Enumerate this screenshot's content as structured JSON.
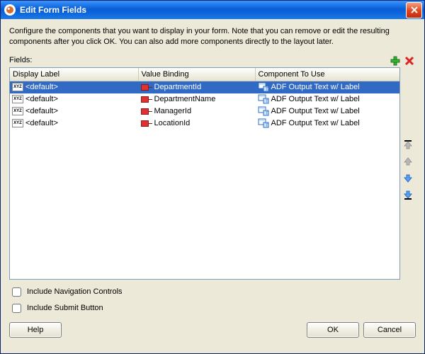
{
  "window": {
    "title": "Edit Form Fields"
  },
  "description": "Configure the components that you want to display in your form.  Note that you can remove or edit the resulting components after you click OK.  You can also add more components directly to the layout later.",
  "fieldsLabel": "Fields:",
  "columns": {
    "displayLabel": "Display Label",
    "valueBinding": "Value Binding",
    "componentToUse": "Component To Use"
  },
  "rows": [
    {
      "label": "<default>",
      "binding": "DepartmentId",
      "component": "ADF Output Text w/ Label",
      "selected": true
    },
    {
      "label": "<default>",
      "binding": "DepartmentName",
      "component": "ADF Output Text w/ Label",
      "selected": false
    },
    {
      "label": "<default>",
      "binding": "ManagerId",
      "component": "ADF Output Text w/ Label",
      "selected": false
    },
    {
      "label": "<default>",
      "binding": "LocationId",
      "component": "ADF Output Text w/ Label",
      "selected": false
    }
  ],
  "options": {
    "includeNavigationControls": {
      "label": "Include Navigation Controls",
      "checked": false
    },
    "includeSubmitButton": {
      "label": "Include Submit Button",
      "checked": false
    }
  },
  "buttons": {
    "help": "Help",
    "ok": "OK",
    "cancel": "Cancel"
  },
  "icons": {
    "add": "add-icon",
    "remove": "remove-icon",
    "moveTop": "move-top-icon",
    "moveUp": "move-up-icon",
    "moveDown": "move-down-icon",
    "moveBottom": "move-bottom-icon"
  }
}
